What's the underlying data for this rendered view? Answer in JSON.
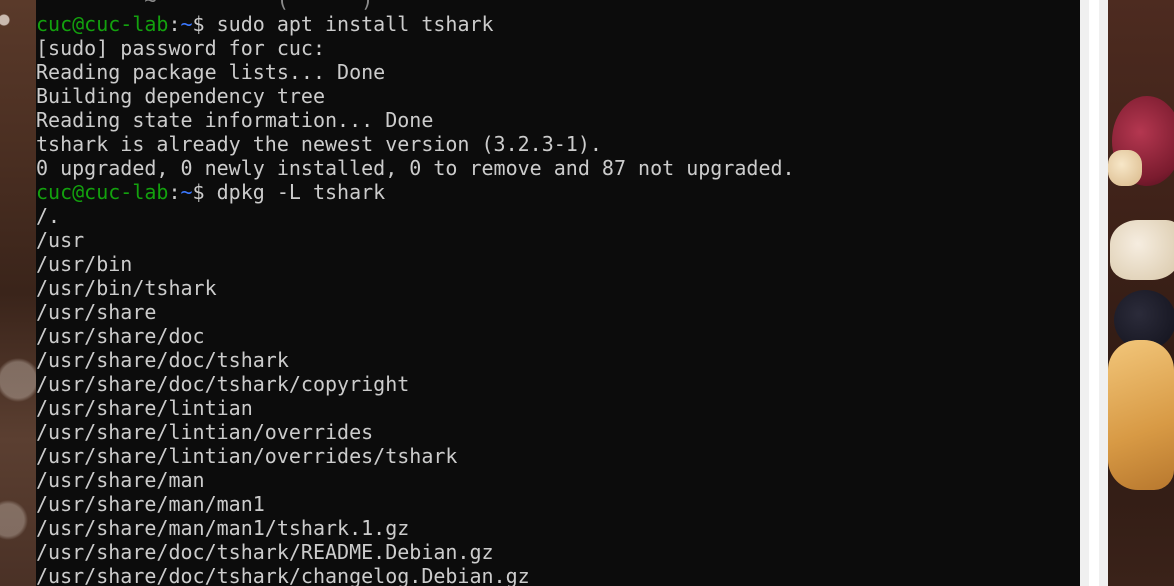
{
  "terminal": {
    "lines": [
      {
        "type": "partial",
        "text": "         ~          (      )"
      },
      {
        "type": "prompt",
        "user": "cuc@cuc-lab",
        "colon": ":",
        "path": "~",
        "sym": "$ ",
        "cmd": "sudo apt install tshark"
      },
      {
        "type": "output",
        "text": "[sudo] password for cuc:"
      },
      {
        "type": "output",
        "text": "Reading package lists... Done"
      },
      {
        "type": "output",
        "text": "Building dependency tree"
      },
      {
        "type": "output",
        "text": "Reading state information... Done"
      },
      {
        "type": "output",
        "text": "tshark is already the newest version (3.2.3-1)."
      },
      {
        "type": "output",
        "text": "0 upgraded, 0 newly installed, 0 to remove and 87 not upgraded."
      },
      {
        "type": "prompt",
        "user": "cuc@cuc-lab",
        "colon": ":",
        "path": "~",
        "sym": "$ ",
        "cmd": "dpkg -L tshark"
      },
      {
        "type": "output",
        "text": "/."
      },
      {
        "type": "output",
        "text": "/usr"
      },
      {
        "type": "output",
        "text": "/usr/bin"
      },
      {
        "type": "output",
        "text": "/usr/bin/tshark"
      },
      {
        "type": "output",
        "text": "/usr/share"
      },
      {
        "type": "output",
        "text": "/usr/share/doc"
      },
      {
        "type": "output",
        "text": "/usr/share/doc/tshark"
      },
      {
        "type": "output",
        "text": "/usr/share/doc/tshark/copyright"
      },
      {
        "type": "output",
        "text": "/usr/share/lintian"
      },
      {
        "type": "output",
        "text": "/usr/share/lintian/overrides"
      },
      {
        "type": "output",
        "text": "/usr/share/lintian/overrides/tshark"
      },
      {
        "type": "output",
        "text": "/usr/share/man"
      },
      {
        "type": "output",
        "text": "/usr/share/man/man1"
      },
      {
        "type": "output",
        "text": "/usr/share/man/man1/tshark.1.gz"
      },
      {
        "type": "output",
        "text": "/usr/share/doc/tshark/README.Debian.gz"
      },
      {
        "type": "output",
        "text": "/usr/share/doc/tshark/changelog.Debian.gz"
      }
    ]
  },
  "colors": {
    "background": "#0c0c0c",
    "text": "#cccccc",
    "prompt_user": "#13a10e",
    "prompt_path": "#3b78ff"
  }
}
